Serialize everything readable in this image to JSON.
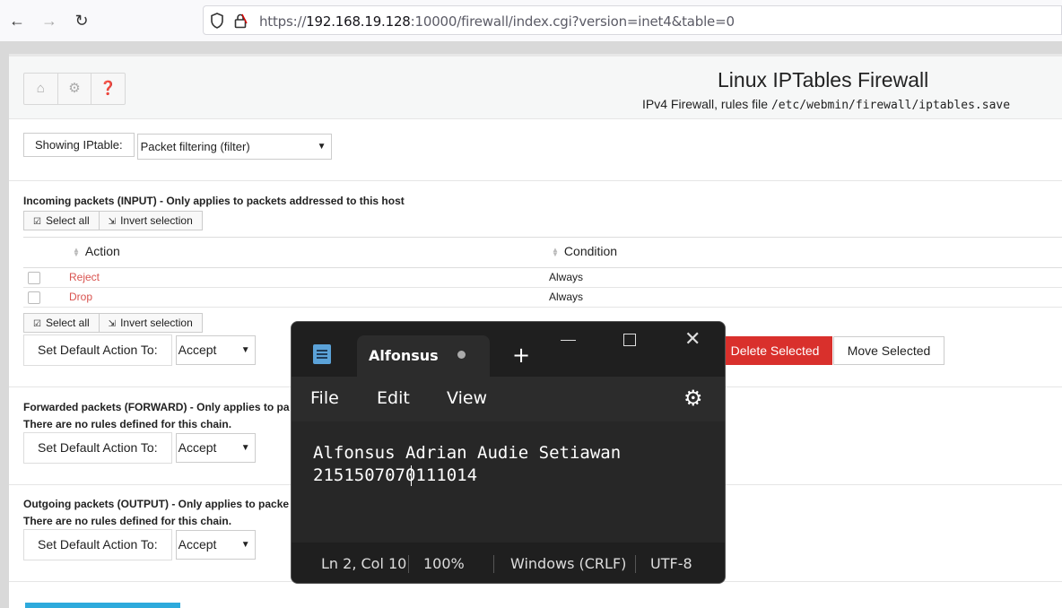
{
  "browser": {
    "url_prefix": "https://",
    "url_host": "192.168.19.128",
    "url_rest": ":10000/firewall/index.cgi?version=inet4&table=0",
    "icons": [
      "back-icon",
      "forward-icon",
      "reload-icon",
      "shield-icon",
      "lock-icon"
    ]
  },
  "header": {
    "title": "Linux IPTables Firewall",
    "subtitle_text": "IPv4 Firewall, rules file ",
    "subtitle_path": "/etc/webmin/firewall/iptables.save",
    "buttons": [
      "home-icon",
      "gear-icon",
      "help-icon"
    ]
  },
  "table_select": {
    "label": "Showing IPtable:",
    "value": "Packet filtering (filter)"
  },
  "input_chain": {
    "title": "Incoming packets (INPUT) - Only applies to packets addressed to this host",
    "select_all": "Select all",
    "invert": "Invert selection",
    "columns": [
      "Action",
      "Condition"
    ],
    "rows": [
      {
        "action": "Reject",
        "condition": "Always"
      },
      {
        "action": "Drop",
        "condition": "Always"
      }
    ],
    "default_label": "Set Default Action To:",
    "default_value": "Accept",
    "delete_label": "Delete Selected",
    "move_label": "Move Selected"
  },
  "forward_chain": {
    "title": "Forwarded packets (FORWARD) - Only applies to pa",
    "no_rules": "There are no rules defined for this chain.",
    "default_label": "Set Default Action To:",
    "default_value": "Accept"
  },
  "output_chain": {
    "title": "Outgoing packets (OUTPUT) - Only applies to packe",
    "no_rules": "There are no rules defined for this chain.",
    "default_label": "Set Default Action To:",
    "default_value": "Accept"
  },
  "notepad": {
    "tab_title": "Alfonsus A",
    "menu": [
      "File",
      "Edit",
      "View"
    ],
    "lines": [
      "Alfonsus Adrian Audie Setiawan",
      "215150707 0111014"
    ],
    "line1": "Alfonsus Adrian Audie Setiawan",
    "line2": "2151507070111014",
    "status": {
      "position": "Ln 2, Col 10",
      "zoom": "100%",
      "line_ending": "Windows (CRLF)",
      "encoding": "UTF-8"
    }
  },
  "colors": {
    "danger": "#d9302c",
    "link_red": "#d9534f",
    "accent_blue": "#2eaadc",
    "notepad_bg": "#272727"
  }
}
